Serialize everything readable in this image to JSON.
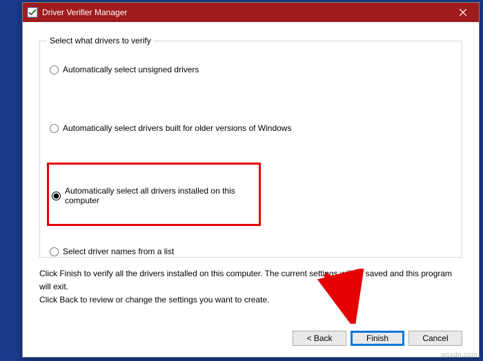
{
  "window": {
    "title": "Driver Verifier Manager"
  },
  "group": {
    "legend": "Select what drivers to verify"
  },
  "radios": {
    "opt1": "Automatically select unsigned drivers",
    "opt2": "Automatically select drivers built for older versions of Windows",
    "opt3": "Automatically select all drivers installed on this computer",
    "opt4": "Select driver names from a list"
  },
  "instructions": {
    "line1": "Click Finish to verify all the drivers installed on this computer. The current settings will be saved and this program will exit.",
    "line2": "Click Back to review or change the settings you want to create."
  },
  "buttons": {
    "back": "< Back",
    "finish": "Finish",
    "cancel": "Cancel"
  },
  "watermark": "wsxdn.com",
  "colors": {
    "titlebar": "#a01c1c",
    "highlight_box": "#e60000",
    "arrow": "#e60000",
    "focus": "#0078d7",
    "desktop": "#1a3b8c"
  }
}
